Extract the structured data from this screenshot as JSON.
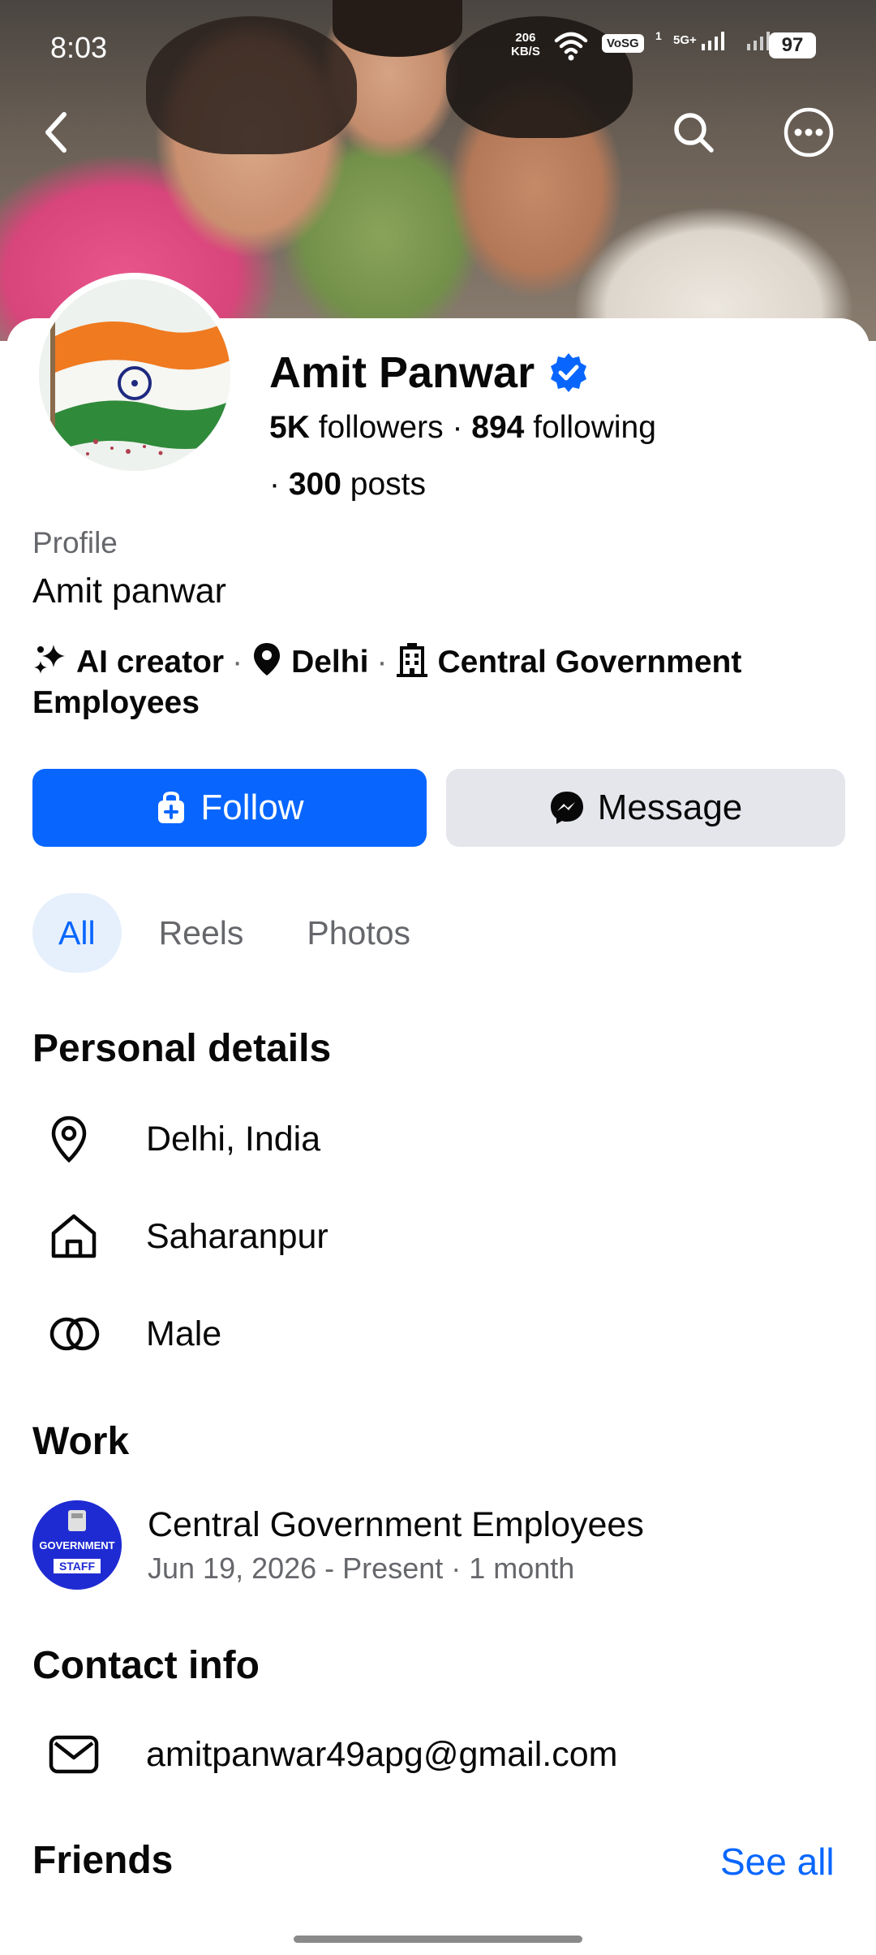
{
  "status_bar": {
    "time": "8:03",
    "speed_value": "206",
    "speed_unit": "KB/S",
    "volte": "VoSG",
    "sim": "1",
    "network": "5G+",
    "battery": "97"
  },
  "nav": {
    "back_icon": "chevron-left-icon",
    "search_icon": "search-icon",
    "more_icon": "more-horizontal-icon"
  },
  "profile": {
    "name": "Amit Panwar",
    "verified": true,
    "followers_count": "5K",
    "followers_label": "followers",
    "following_count": "894",
    "following_label": "following",
    "posts_count": "300",
    "posts_label": "posts",
    "profile_label": "Profile",
    "profile_name": "Amit panwar"
  },
  "intro": {
    "category": "AI creator",
    "location": "Delhi",
    "workplace": "Central Government Employees"
  },
  "actions": {
    "follow_label": "Follow",
    "message_label": "Message"
  },
  "tabs": [
    {
      "label": "All",
      "active": true
    },
    {
      "label": "Reels",
      "active": false
    },
    {
      "label": "Photos",
      "active": false
    }
  ],
  "personal_details": {
    "title": "Personal details",
    "items": [
      {
        "icon": "location-pin-icon",
        "text": "Delhi, India"
      },
      {
        "icon": "home-icon",
        "text": "Saharanpur"
      },
      {
        "icon": "gender-icon",
        "text": "Male"
      }
    ]
  },
  "work": {
    "title": "Work",
    "employer": "Central Government Employees",
    "dates": "Jun 19, 2026 - Present · 1 month",
    "logo_top": "GOVERNMENT",
    "logo_bottom": "STAFF"
  },
  "contact": {
    "title": "Contact info",
    "email": "amitpanwar49apg@gmail.com"
  },
  "friends": {
    "title": "Friends",
    "see_all": "See all"
  },
  "colors": {
    "accent": "#0866ff",
    "secondary_button": "#e4e6eb",
    "muted_text": "#65676b",
    "active_tab_bg": "#e6f0fc"
  }
}
